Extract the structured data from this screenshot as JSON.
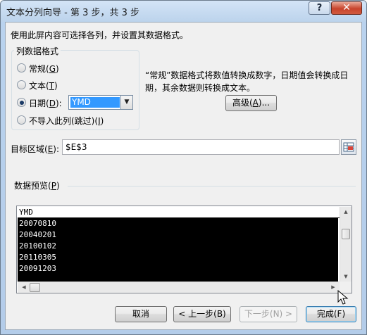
{
  "window": {
    "title": "文本分列向导 - 第 3 步，共 3 步",
    "help_glyph": "?",
    "close_glyph": "✕"
  },
  "instruction": "使用此屏内容可选择各列，并设置其数据格式。",
  "column_format": {
    "title": "列数据格式",
    "options": [
      {
        "label": "常规",
        "key": "G",
        "checked": false
      },
      {
        "label": "文本",
        "key": "T",
        "checked": false
      },
      {
        "label": "日期",
        "key": "D",
        "checked": true
      },
      {
        "label": "不导入此列(跳过)",
        "key": "I",
        "checked": false
      }
    ],
    "date_format_selected": "YMD"
  },
  "description": "“常规”数据格式将数值转换成数字，日期值会转换成日期，其余数据则转换成文本。",
  "advanced_button": {
    "label": "高级",
    "key": "A"
  },
  "destination": {
    "label": "目标区域",
    "key": "E",
    "value": "$E$3"
  },
  "preview": {
    "title": "数据预览",
    "key": "P",
    "header": "YMD",
    "rows": [
      "20070810",
      "20040201",
      "20100102",
      "20110305",
      "20091203"
    ]
  },
  "buttons": {
    "cancel": "取消",
    "back": "< 上一步(B)",
    "next": "下一步(N) >",
    "finish": "完成(F)"
  }
}
